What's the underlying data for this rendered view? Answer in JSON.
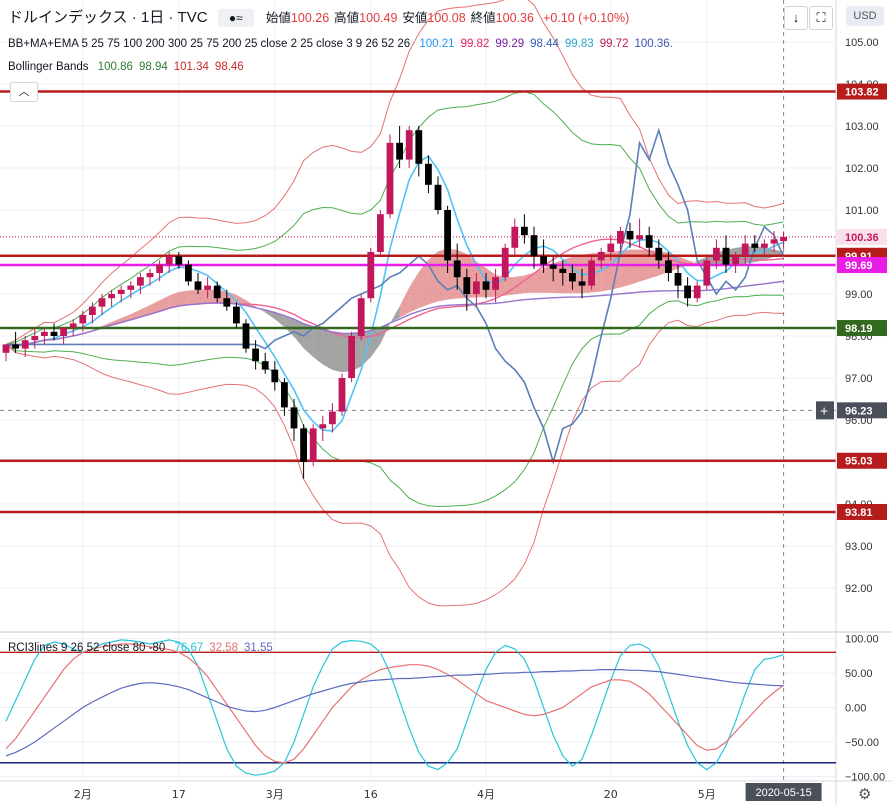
{
  "header": {
    "title": "ドルインデックス · 1日 · TVC",
    "ohlc": [
      {
        "label": "始値",
        "value": "100.26"
      },
      {
        "label": "高値",
        "value": "100.49"
      },
      {
        "label": "安値",
        "value": "100.08"
      },
      {
        "label": "終値",
        "value": "100.36"
      }
    ],
    "change": "+0.10 (+0.10%)",
    "currency": "USD"
  },
  "indicators": {
    "bbma": {
      "label": "BB+MA+EMA 5 25 75 100 200 300 25 75 200 25 close 2 25 close 3 9 26 52 26",
      "values": [
        {
          "v": "100.21",
          "c": "#2196f3"
        },
        {
          "v": "99.82",
          "c": "#e91e63"
        },
        {
          "v": "99.29",
          "c": "#7b1fa2"
        },
        {
          "v": "98.44",
          "c": "#3a5bbf"
        },
        {
          "v": "99.83",
          "c": "#26a6c9"
        },
        {
          "v": "99.72",
          "c": "#c2185b"
        },
        {
          "v": "100.36.",
          "c": "#3f51b5"
        }
      ]
    },
    "bollinger": {
      "label": "Bollinger Bands",
      "values": [
        {
          "v": "100.86",
          "c": "#2e7d32"
        },
        {
          "v": "98.94",
          "c": "#2e7d32"
        },
        {
          "v": "101.34",
          "c": "#c62828"
        },
        {
          "v": "98.46",
          "c": "#c62828"
        }
      ]
    },
    "rci": {
      "label": "RCI3lines 9 26 52 close 80 -80",
      "values": [
        {
          "v": "76.67",
          "c": "#26c6da"
        },
        {
          "v": "32.58",
          "c": "#e57373"
        },
        {
          "v": "31.55",
          "c": "#5c6bc0"
        }
      ]
    }
  },
  "colors": {
    "candle_up": "#c2185b",
    "candle_down": "#000000",
    "level_red": "#b71c1c",
    "level_green": "#33691e",
    "level_magenta": "#e91ee6",
    "last_price": "#c2185b",
    "crosshair_tag": "#4a4f5a"
  },
  "chart_data": [
    {
      "type": "candlestick",
      "title": "ドルインデックス · 1日 · TVC",
      "x_ticks": [
        "2月",
        "17",
        "3月",
        "16",
        "4月",
        "20",
        "5月"
      ],
      "y_ticks": [
        92.0,
        93.0,
        94.0,
        95.0,
        96.0,
        97.0,
        98.0,
        99.0,
        100.0,
        101.0,
        102.0,
        103.0,
        104.0,
        105.0
      ],
      "ylim": [
        91.0,
        106.0
      ],
      "date_label": "2020-05-15",
      "last_price": 100.36,
      "crosshair_price": 96.23,
      "horizontal_levels": [
        {
          "value": 103.82,
          "color": "#b71c1c"
        },
        {
          "value": 99.91,
          "color": "#b71c1c"
        },
        {
          "value": 99.69,
          "color": "#e91ee6"
        },
        {
          "value": 98.19,
          "color": "#33691e"
        },
        {
          "value": 95.03,
          "color": "#b71c1c"
        },
        {
          "value": 93.81,
          "color": "#b71c1c"
        }
      ],
      "candles_ohlc": [
        [
          97.6,
          97.8,
          97.4,
          97.8
        ],
        [
          97.8,
          98.1,
          97.6,
          97.7
        ],
        [
          97.7,
          98.0,
          97.5,
          97.9
        ],
        [
          97.9,
          98.2,
          97.7,
          98.0
        ],
        [
          98.0,
          98.2,
          97.8,
          98.1
        ],
        [
          98.1,
          98.3,
          97.9,
          98.0
        ],
        [
          98.0,
          98.2,
          97.8,
          98.2
        ],
        [
          98.2,
          98.4,
          98.0,
          98.3
        ],
        [
          98.3,
          98.6,
          98.1,
          98.5
        ],
        [
          98.5,
          98.8,
          98.3,
          98.7
        ],
        [
          98.7,
          99.0,
          98.5,
          98.9
        ],
        [
          98.9,
          99.1,
          98.7,
          99.0
        ],
        [
          99.0,
          99.2,
          98.8,
          99.1
        ],
        [
          99.1,
          99.3,
          98.9,
          99.2
        ],
        [
          99.2,
          99.5,
          99.0,
          99.4
        ],
        [
          99.4,
          99.6,
          99.2,
          99.5
        ],
        [
          99.5,
          99.8,
          99.3,
          99.7
        ],
        [
          99.7,
          100.0,
          99.5,
          99.9
        ],
        [
          99.9,
          100.0,
          99.6,
          99.7
        ],
        [
          99.7,
          99.8,
          99.2,
          99.3
        ],
        [
          99.3,
          99.5,
          99.0,
          99.1
        ],
        [
          99.1,
          99.4,
          98.9,
          99.2
        ],
        [
          99.2,
          99.3,
          98.8,
          98.9
        ],
        [
          98.9,
          99.1,
          98.6,
          98.7
        ],
        [
          98.7,
          98.8,
          98.2,
          98.3
        ],
        [
          98.3,
          98.4,
          97.6,
          97.7
        ],
        [
          97.7,
          97.9,
          97.2,
          97.4
        ],
        [
          97.4,
          97.6,
          97.1,
          97.2
        ],
        [
          97.2,
          97.4,
          96.7,
          96.9
        ],
        [
          96.9,
          97.0,
          96.1,
          96.3
        ],
        [
          96.3,
          96.5,
          95.5,
          95.8
        ],
        [
          95.8,
          95.9,
          94.6,
          95.0
        ],
        [
          95.0,
          95.9,
          94.9,
          95.8
        ],
        [
          95.8,
          96.1,
          95.5,
          95.9
        ],
        [
          95.9,
          96.4,
          95.7,
          96.2
        ],
        [
          96.2,
          97.1,
          96.1,
          97.0
        ],
        [
          97.0,
          98.1,
          96.9,
          98.0
        ],
        [
          98.0,
          99.0,
          97.9,
          98.9
        ],
        [
          98.9,
          100.1,
          98.8,
          100.0
        ],
        [
          100.0,
          101.0,
          99.9,
          100.9
        ],
        [
          100.9,
          102.8,
          100.8,
          102.6
        ],
        [
          102.6,
          103.0,
          102.0,
          102.2
        ],
        [
          102.2,
          103.0,
          102.0,
          102.9
        ],
        [
          102.9,
          103.0,
          101.8,
          102.1
        ],
        [
          102.1,
          102.3,
          101.4,
          101.6
        ],
        [
          101.6,
          101.8,
          100.9,
          101.0
        ],
        [
          101.0,
          101.1,
          99.5,
          99.8
        ],
        [
          99.8,
          100.2,
          99.1,
          99.4
        ],
        [
          99.4,
          99.6,
          98.6,
          99.0
        ],
        [
          99.0,
          99.5,
          98.7,
          99.3
        ],
        [
          99.3,
          99.5,
          98.9,
          99.1
        ],
        [
          99.1,
          99.6,
          98.8,
          99.4
        ],
        [
          99.4,
          100.2,
          99.3,
          100.1
        ],
        [
          100.1,
          100.8,
          99.9,
          100.6
        ],
        [
          100.6,
          100.9,
          100.2,
          100.4
        ],
        [
          100.4,
          100.6,
          99.6,
          99.9
        ],
        [
          99.9,
          100.3,
          99.5,
          99.7
        ],
        [
          99.7,
          99.9,
          99.3,
          99.6
        ],
        [
          99.6,
          99.8,
          99.2,
          99.5
        ],
        [
          99.5,
          99.7,
          99.1,
          99.3
        ],
        [
          99.3,
          99.6,
          98.9,
          99.2
        ],
        [
          99.2,
          99.9,
          99.1,
          99.8
        ],
        [
          99.8,
          100.1,
          99.6,
          100.0
        ],
        [
          100.0,
          100.4,
          99.8,
          100.2
        ],
        [
          100.2,
          100.6,
          100.0,
          100.5
        ],
        [
          100.5,
          100.7,
          100.1,
          100.3
        ],
        [
          100.3,
          100.8,
          100.1,
          100.4
        ],
        [
          100.4,
          100.6,
          99.9,
          100.1
        ],
        [
          100.1,
          100.3,
          99.6,
          99.8
        ],
        [
          99.8,
          100.0,
          99.3,
          99.5
        ],
        [
          99.5,
          99.7,
          98.9,
          99.2
        ],
        [
          99.2,
          99.4,
          98.7,
          98.9
        ],
        [
          98.9,
          99.3,
          98.8,
          99.2
        ],
        [
          99.2,
          99.9,
          99.1,
          99.8
        ],
        [
          99.8,
          100.3,
          99.6,
          100.1
        ],
        [
          100.1,
          100.4,
          99.5,
          99.7
        ],
        [
          99.7,
          100.0,
          99.5,
          99.9
        ],
        [
          99.9,
          100.4,
          99.7,
          100.2
        ],
        [
          100.2,
          100.4,
          100.0,
          100.1
        ],
        [
          100.1,
          100.3,
          99.9,
          100.2
        ],
        [
          100.2,
          100.5,
          100.0,
          100.3
        ],
        [
          100.26,
          100.49,
          100.08,
          100.36
        ]
      ]
    },
    {
      "type": "line",
      "title": "RCI3lines 9 26 52 close 80 -80",
      "y_ticks": [
        -100.0,
        -50.0,
        0.0,
        50.0,
        100.0
      ],
      "ylim": [
        -105,
        108
      ],
      "levels": [
        80,
        -80
      ],
      "series": [
        {
          "name": "9",
          "color": "#26c6da",
          "values": [
            -20,
            10,
            40,
            70,
            90,
            95,
            92,
            85,
            80,
            85,
            92,
            95,
            98,
            97,
            95,
            92,
            95,
            98,
            95,
            85,
            60,
            20,
            -20,
            -60,
            -85,
            -95,
            -98,
            -96,
            -92,
            -80,
            -50,
            -10,
            30,
            60,
            85,
            95,
            97,
            96,
            92,
            80,
            50,
            10,
            -30,
            -65,
            -85,
            -90,
            -80,
            -60,
            -20,
            20,
            55,
            80,
            90,
            85,
            70,
            40,
            0,
            -40,
            -70,
            -85,
            -75,
            -40,
            0,
            40,
            75,
            90,
            92,
            85,
            60,
            20,
            -20,
            -55,
            -80,
            -90,
            -80,
            -55,
            -20,
            20,
            55,
            70,
            72,
            76.67
          ]
        },
        {
          "name": "26",
          "color": "#e57373",
          "values": [
            -60,
            -45,
            -25,
            -5,
            15,
            35,
            55,
            70,
            80,
            85,
            88,
            90,
            92,
            92,
            90,
            88,
            86,
            84,
            80,
            72,
            60,
            45,
            25,
            5,
            -15,
            -35,
            -55,
            -70,
            -78,
            -80,
            -75,
            -60,
            -40,
            -20,
            0,
            15,
            30,
            40,
            48,
            55,
            58,
            60,
            62,
            62,
            60,
            55,
            48,
            40,
            30,
            20,
            10,
            5,
            0,
            -5,
            -10,
            -12,
            -10,
            -5,
            0,
            10,
            20,
            30,
            35,
            40,
            40,
            38,
            30,
            20,
            5,
            -10,
            -25,
            -40,
            -55,
            -62,
            -60,
            -50,
            -35,
            -20,
            -5,
            10,
            22,
            32.58
          ]
        },
        {
          "name": "52",
          "color": "#5c6bc0",
          "values": [
            -70,
            -65,
            -58,
            -50,
            -40,
            -30,
            -20,
            -10,
            0,
            8,
            15,
            22,
            28,
            32,
            35,
            36,
            35,
            33,
            30,
            26,
            20,
            14,
            8,
            2,
            -2,
            -5,
            -6,
            -4,
            0,
            5,
            10,
            15,
            20,
            24,
            28,
            32,
            35,
            37,
            39,
            40,
            41,
            42,
            42,
            43,
            44,
            45,
            46,
            47,
            47,
            48,
            48,
            49,
            50,
            50,
            51,
            51,
            52,
            52,
            53,
            53,
            54,
            54,
            55,
            55,
            55,
            54,
            54,
            53,
            52,
            50,
            48,
            46,
            44,
            42,
            40,
            38,
            36,
            35,
            34,
            33,
            32,
            31.55
          ]
        }
      ]
    }
  ]
}
